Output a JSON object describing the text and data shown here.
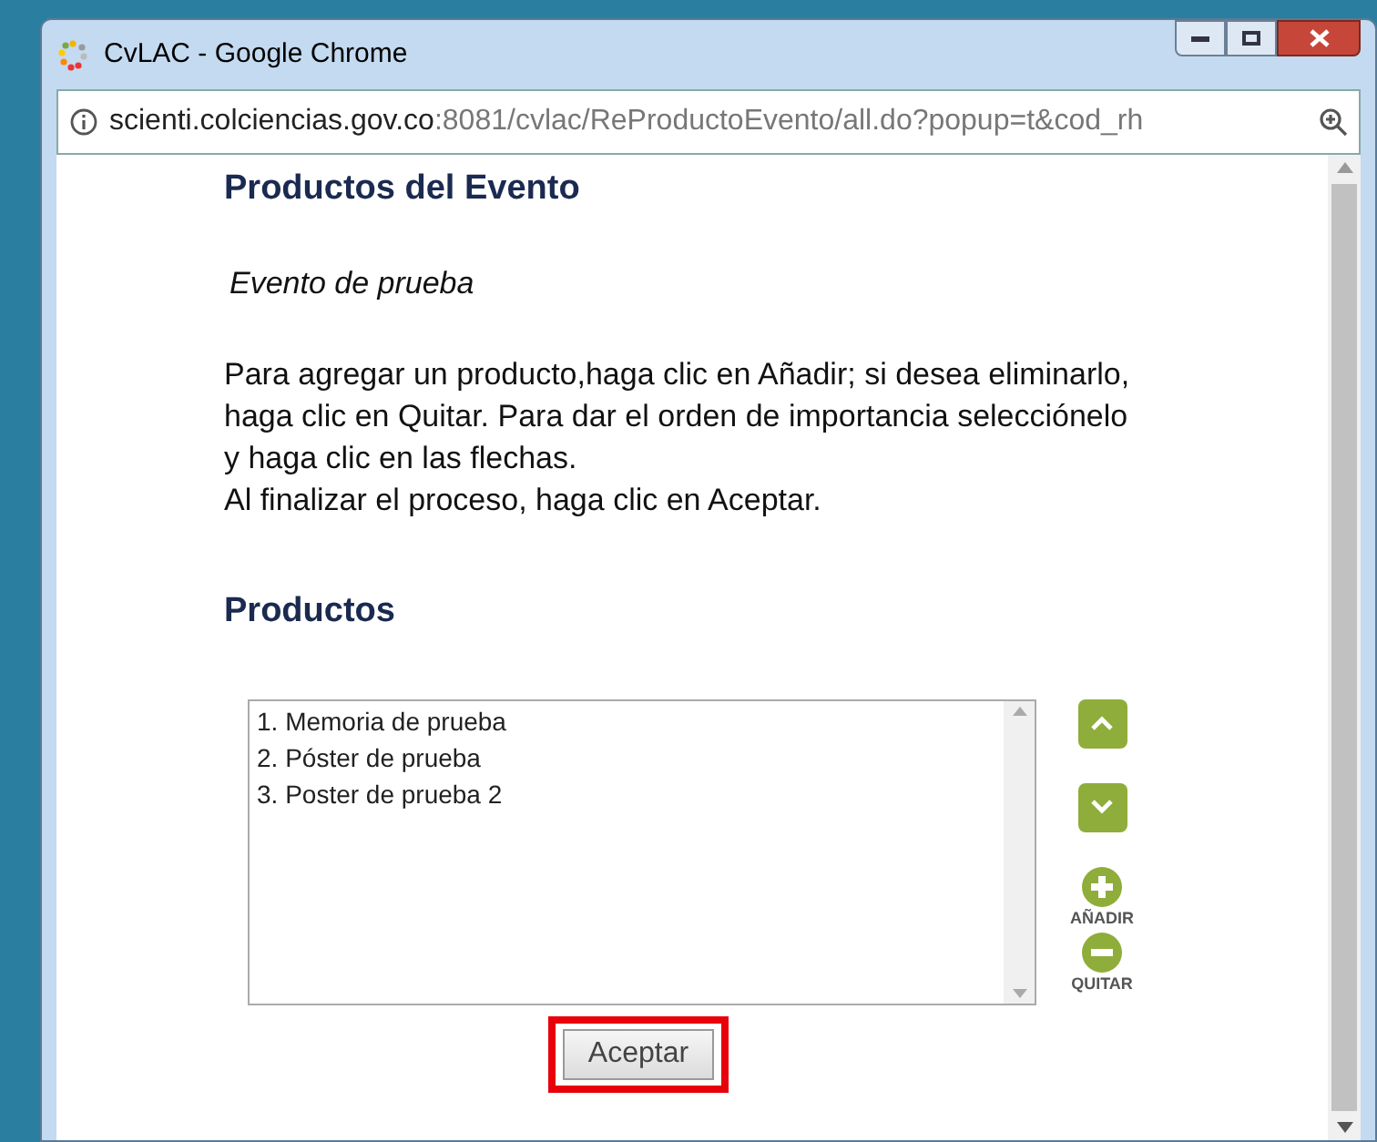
{
  "window": {
    "title": "CvLAC - Google Chrome"
  },
  "address_bar": {
    "host": "scienti.colciencias.gov.co",
    "path": ":8081/cvlac/ReProductoEvento/all.do?popup=t&cod_rh"
  },
  "page": {
    "heading": "Productos del Evento",
    "event_name": "Evento de prueba",
    "instructions": [
      "Para agregar un producto,haga clic en Añadir; si desea eliminarlo, haga clic en Quitar. Para dar el orden de importancia selecciónelo y haga clic en las flechas.",
      "Al finalizar el proceso, haga clic en Aceptar."
    ],
    "products_heading": "Productos",
    "products": [
      {
        "label": "1. Memoria de prueba",
        "selected": false
      },
      {
        "label": "2. Póster de prueba",
        "selected": false
      },
      {
        "label": "3. Poster de prueba 2",
        "selected": false
      }
    ],
    "add_label": "AÑADIR",
    "remove_label": "QUITAR",
    "accept_button": "Aceptar"
  }
}
